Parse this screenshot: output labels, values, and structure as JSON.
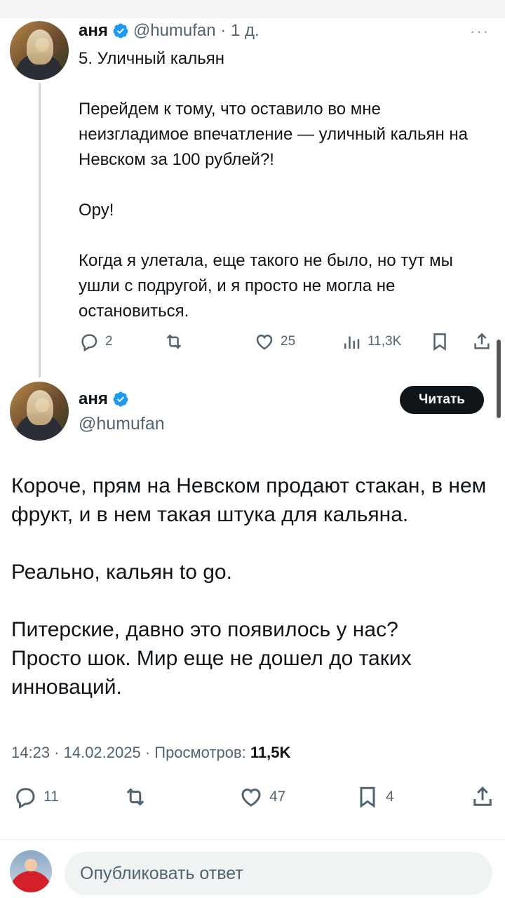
{
  "tweet1": {
    "name": "аня",
    "handle_time": "@humufan · 1 д.",
    "body": "5. Уличный кальян\n\nПерейдем к тому, что оставило во мне неизгладимое впечатление — уличный кальян на Невском за 100 рублей?!\n\nОру!\n\nКогда я улетала, еще такого не было, но тут мы ушли с подругой, и я просто не могла не остановиться.",
    "stats": {
      "replies": "2",
      "likes": "25",
      "views": "11,3K"
    }
  },
  "tweet2": {
    "name": "аня",
    "handle": "@humufan",
    "follow_label": "Читать",
    "body": "Короче, прям на Невском продают стакан, в нем фрукт, и в нем такая штука для кальяна.\n\nРеально, кальян to go.\n\nПитерские, давно это появилось у нас?\nПросто шок. Мир еще не дошел до таких инноваций.",
    "time": "14:23 · 14.02.2025 · Просмотров: ",
    "views": "11,5K",
    "stats": {
      "replies": "11",
      "likes": "47",
      "bookmarks": "4"
    }
  },
  "reply": {
    "placeholder": "Опубликовать ответ"
  },
  "icons": [
    "verified-badge-icon",
    "more-icon",
    "reply-icon",
    "retweet-icon",
    "like-icon",
    "views-icon",
    "bookmark-icon",
    "share-icon"
  ],
  "colors": {
    "verified": "#1d9bf0",
    "text": "#0f1419",
    "muted": "#536471",
    "button": "#0f1419"
  }
}
